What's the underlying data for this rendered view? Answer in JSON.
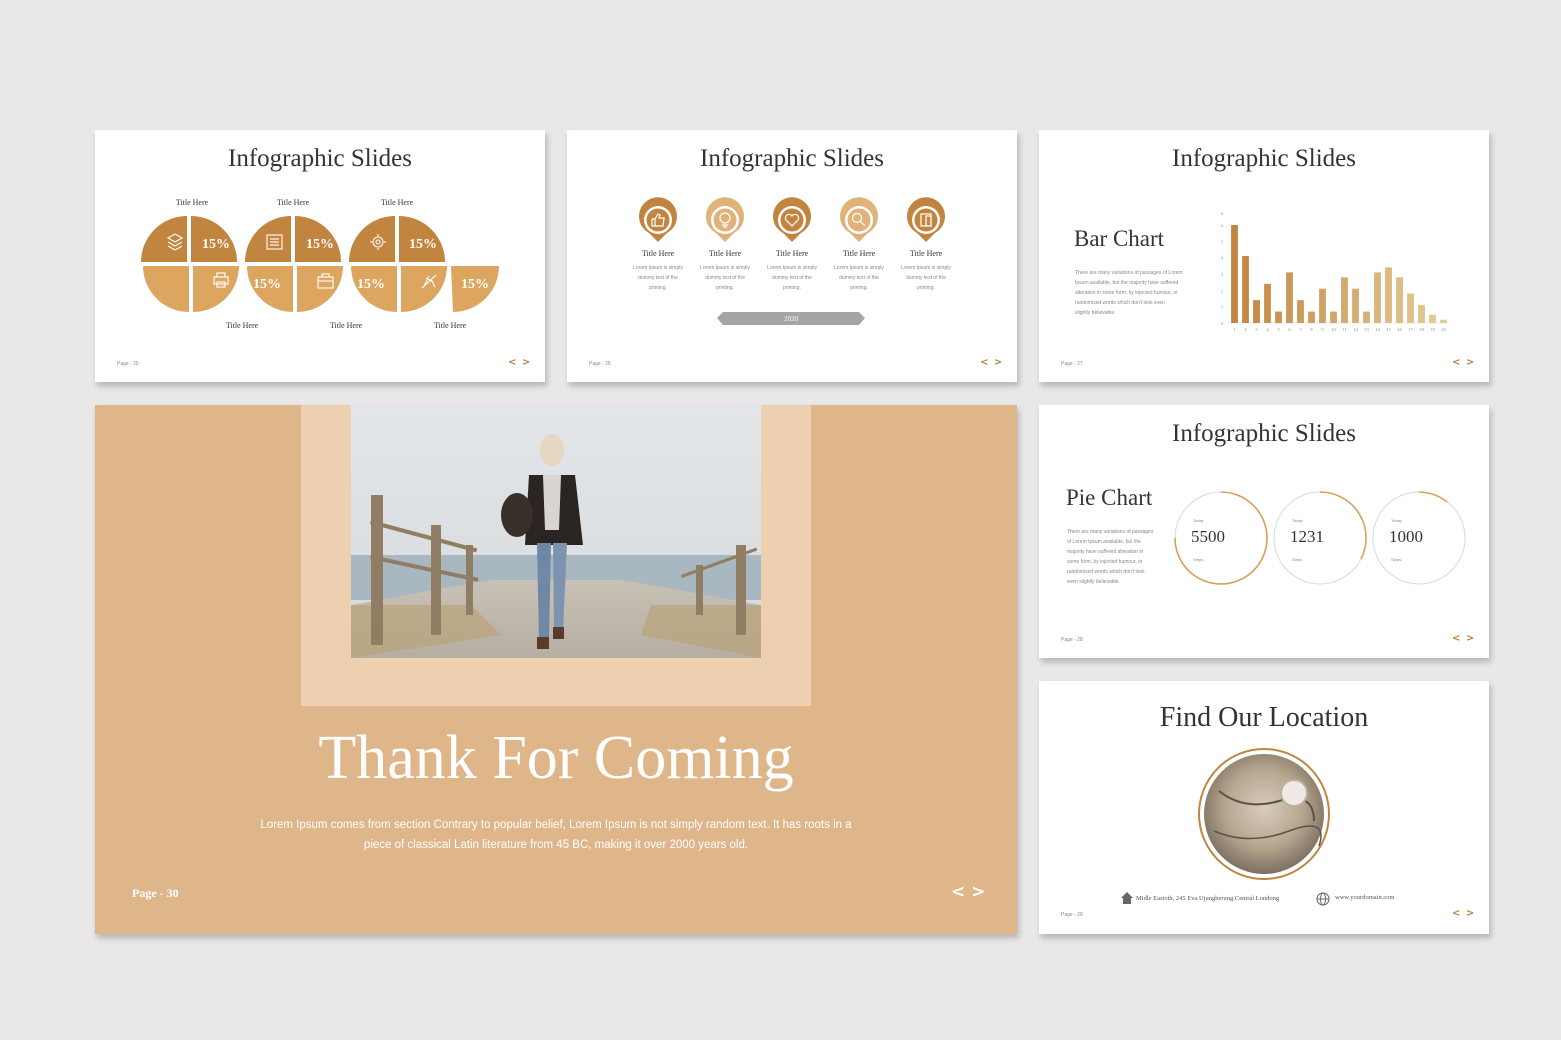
{
  "colors": {
    "bg": "#e9e7e8",
    "accent": "#c1853f",
    "accent_light": "#dca660",
    "peach": "#dfb68a",
    "peach_light": "#ecd0b0",
    "tan_bar": "#e3c68d"
  },
  "slide1": {
    "title": "Infographic Slides",
    "top_labels": [
      "Title Here",
      "Title Here",
      "Title Here"
    ],
    "bottom_labels": [
      "Title Here",
      "Title Here",
      "Title Here"
    ],
    "percent_top": [
      "15%",
      "15%",
      "15%"
    ],
    "percent_bottom": [
      "15%",
      "15%",
      "15%"
    ],
    "icons_top": [
      "layers-icon",
      "list-icon",
      "gear-icon"
    ],
    "icons_bottom": [
      "printer-icon",
      "briefcase-icon",
      "airplane-icon"
    ],
    "page": "Page - 25",
    "nav": "< >"
  },
  "slide2": {
    "title": "Infographic Slides",
    "pins": [
      {
        "icon": "thumbs-up-icon",
        "title": "Title Here",
        "l1": "Lorem Ipsum is simply",
        "l2": "dummy text of the",
        "l3": "printing."
      },
      {
        "icon": "lightbulb-icon",
        "title": "Title Here",
        "l1": "Lorem Ipsum is simply",
        "l2": "dummy text of the",
        "l3": "printing."
      },
      {
        "icon": "heart-icon",
        "title": "Title Here",
        "l1": "Lorem Ipsum is simply",
        "l2": "dummy text of the",
        "l3": "printing."
      },
      {
        "icon": "search-icon",
        "title": "Title Here",
        "l1": "Lorem Ipsum is simply",
        "l2": "dummy text of the",
        "l3": "printing."
      },
      {
        "icon": "door-icon",
        "title": "Title Here",
        "l1": "Lorem Ipsum is simply",
        "l2": "dummy text of the",
        "l3": "printing."
      }
    ],
    "year": "2020",
    "page": "Page - 26",
    "nav": "< >"
  },
  "slide3": {
    "title": "Infographic Slides",
    "heading": "Bar Chart",
    "lines": [
      "There are many variations of passages of Lorem",
      "Ipsum available, but the majority have suffered",
      "alteration in some form, by injected humour, or",
      "randomised words which don't look even",
      "slightly believable."
    ],
    "page": "Page - 27",
    "nav": "< >"
  },
  "chart_data": {
    "type": "bar",
    "categories": [
      "1",
      "2",
      "3",
      "4",
      "5",
      "6",
      "7",
      "8",
      "9",
      "10",
      "11",
      "12",
      "13",
      "14",
      "15",
      "16",
      "17",
      "18",
      "19",
      "20"
    ],
    "values": [
      6,
      4.1,
      1.4,
      2.4,
      0.7,
      3.1,
      1.4,
      0.7,
      2.1,
      0.7,
      2.8,
      2.1,
      0.7,
      3.1,
      3.4,
      2.8,
      1.8,
      1.1,
      0.5,
      0.2
    ],
    "ylim": [
      0,
      6
    ],
    "yticks": [
      "0",
      "1",
      "2",
      "3",
      "4",
      "5",
      "6",
      "6"
    ],
    "grid": false
  },
  "slide4": {
    "title": "Infographic Slides",
    "heading": "Pie Chart",
    "lines": [
      "There are many variations of passages",
      "of Lorem Ipsum available, but the",
      "majority have suffered alteration in",
      "some form, by injected humour, or",
      "randomised words which don't look",
      "even slightly believable."
    ],
    "circles": [
      {
        "top": "Today",
        "value": "5500",
        "bottom": "Steps"
      },
      {
        "top": "Today",
        "value": "1231",
        "bottom": "Steps"
      },
      {
        "top": "Today",
        "value": "1000",
        "bottom": "Steps"
      }
    ],
    "page": "Page - 28",
    "nav": "< >"
  },
  "slide5": {
    "title": "Find Our Location",
    "address": "Midle Eastoth, 245 Eva.Ujungberung.Central Londong",
    "website": "www.yourdomain.com",
    "page": "Page - 29",
    "nav": "< >"
  },
  "slide6": {
    "title": "Thank For Coming",
    "line1": "Lorem Ipsum comes from section Contrary to popular belief, Lorem Ipsum is not simply random text. It has roots in a",
    "line2": "piece of classical Latin literature from 45 BC, making it over 2000 years old.",
    "page": "Page - 30",
    "nav": "< >"
  }
}
